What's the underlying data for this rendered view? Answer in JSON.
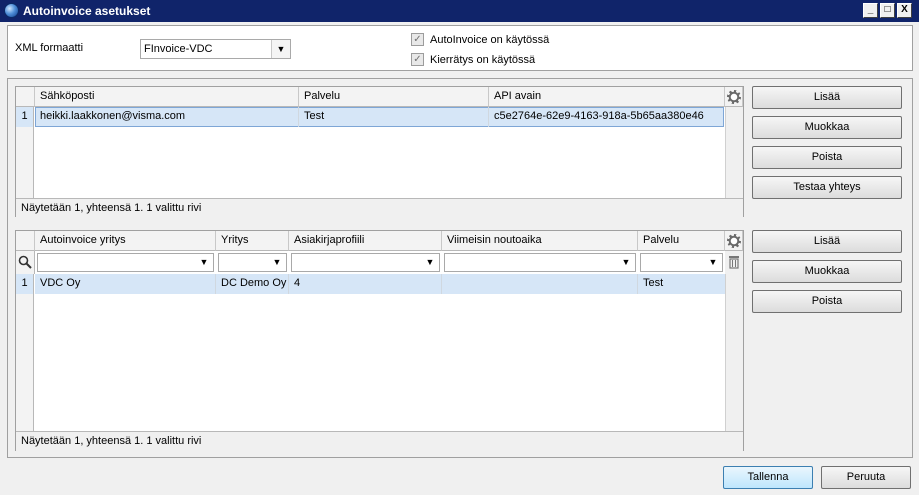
{
  "window": {
    "title": "Autoinvoice asetukset",
    "minimize": "_",
    "maximize": "□",
    "close": "X"
  },
  "settings": {
    "xml_format_label": "XML formaatti",
    "xml_format_value": "FInvoice-VDC",
    "autoinvoice_enabled_label": "AutoInvoice on käytössä",
    "autoinvoice_enabled": true,
    "recycling_enabled_label": "Kierrätys on käytössä",
    "recycling_enabled": true
  },
  "email_grid": {
    "columns": [
      "Sähköposti",
      "Palvelu",
      "API avain"
    ],
    "rows": [
      {
        "num": "1",
        "email": "heikki.laakkonen@visma.com",
        "service": "Test",
        "api_key": "c5e2764e-62e9-4163-918a-5b65aa380e46"
      }
    ],
    "footer": "Näytetään 1, yhteensä 1. 1 valittu rivi",
    "buttons": {
      "add": "Lisää",
      "edit": "Muokkaa",
      "delete": "Poista",
      "test": "Testaa yhteys"
    }
  },
  "company_grid": {
    "columns": [
      "Autoinvoice yritys",
      "Yritys",
      "Asiakirjaprofiili",
      "Viimeisin noutoaika",
      "Palvelu"
    ],
    "rows": [
      {
        "num": "1",
        "ai_company": "VDC Oy",
        "company": "DC Demo Oy",
        "profile": "4",
        "last_fetch": "",
        "service": "Test"
      }
    ],
    "footer": "Näytetään 1, yhteensä 1. 1 valittu rivi",
    "buttons": {
      "add": "Lisää",
      "edit": "Muokkaa",
      "delete": "Poista"
    }
  },
  "actions": {
    "save": "Tallenna",
    "cancel": "Peruuta"
  }
}
